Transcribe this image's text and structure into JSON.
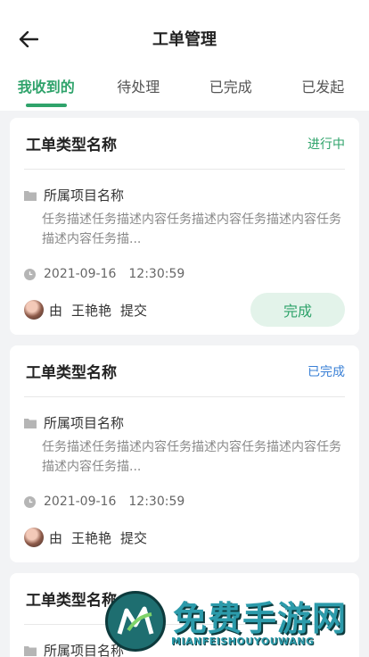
{
  "header": {
    "title": "工单管理",
    "back_icon": "arrow-left-icon"
  },
  "tabs": [
    {
      "label": "我收到的",
      "active": true
    },
    {
      "label": "待处理",
      "active": false
    },
    {
      "label": "已完成",
      "active": false
    },
    {
      "label": "已发起",
      "active": false
    }
  ],
  "colors": {
    "accent": "#2fa36b",
    "done_status": "#3a80d6"
  },
  "cards": [
    {
      "type_name": "工单类型名称",
      "status": "进行中",
      "project": "所属项目名称",
      "desc": "任务描述任务描述内容任务描述内容任务描述内容任务描述内容任务描...",
      "date": "2021-09-16",
      "time": "12:30:59",
      "by": "由",
      "submitter": "王艳艳",
      "action": "提交",
      "button": "完成"
    },
    {
      "type_name": "工单类型名称",
      "status": "已完成",
      "project": "所属项目名称",
      "desc": "任务描述任务描述内容任务描述内容任务描述内容任务描述内容任务描...",
      "date": "2021-09-16",
      "time": "12:30:59",
      "by": "由",
      "submitter": "王艳艳",
      "action": "提交"
    },
    {
      "type_name": "工单类型名称",
      "project": "所属项目名称"
    }
  ],
  "watermark": {
    "title": "免费手游网",
    "subtitle": "MIANFEISHOUYOUWANG"
  }
}
